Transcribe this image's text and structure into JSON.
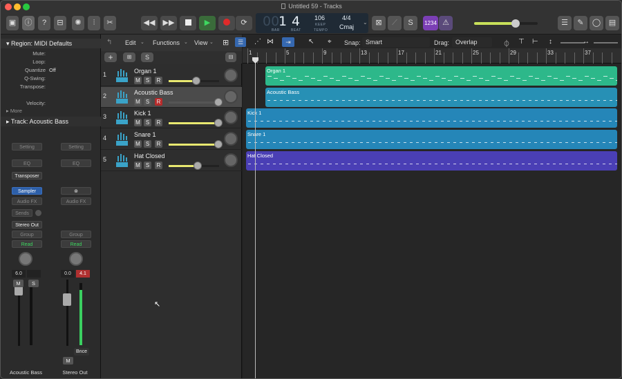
{
  "window": {
    "title": "Untitled 59 - Tracks"
  },
  "lcd": {
    "bar": "1",
    "beat": "4",
    "bar_label": "BAR",
    "beat_label": "BEAT",
    "tempo": "106",
    "keep_label": "KEEP",
    "tempo_label": "TEMPO",
    "time_sig": "4/4",
    "key": "Cmaj"
  },
  "toolbar": {
    "count_in": "1234"
  },
  "edit_toolbar": {
    "edit": "Edit",
    "functions": "Functions",
    "view": "View",
    "snap_label": "Snap:",
    "snap_value": "Smart",
    "drag_label": "Drag:",
    "drag_value": "Overlap"
  },
  "ruler": {
    "bars": [
      "1",
      "5",
      "9",
      "13",
      "17",
      "21",
      "25",
      "29",
      "33",
      "37"
    ]
  },
  "inspector": {
    "region_header": "Region: MIDI Defaults",
    "rows": [
      {
        "label": "Mute:",
        "value": ""
      },
      {
        "label": "Loop:",
        "value": ""
      },
      {
        "label": "Quantize",
        "value": "Off"
      },
      {
        "label": "Q-Swing:",
        "value": ""
      },
      {
        "label": "Transpose:",
        "value": ""
      },
      {
        "label": "",
        "value": ""
      },
      {
        "label": "Velocity:",
        "value": ""
      }
    ],
    "more": "More",
    "track_header": "Track:  Acoustic Bass",
    "strip1": {
      "setting": "Setting",
      "eq": "EQ",
      "midi_fx": "Transposer",
      "instrument": "Sampler",
      "audio_fx": "Audio FX",
      "sends": "Sends",
      "output": "Stereo Out",
      "group": "Group",
      "automation": "Read",
      "volume": "6.0",
      "mute": "M",
      "solo": "S",
      "name": "Acoustic Bass"
    },
    "strip2": {
      "setting": "Setting",
      "eq": "EQ",
      "audio_fx": "Audio FX",
      "group": "Group",
      "automation": "Read",
      "volume": "0.0",
      "peak": "4.1",
      "bounce": "Bnce",
      "mute": "M",
      "name": "Stereo Out"
    }
  },
  "tracks": [
    {
      "num": "1",
      "name": "Organ 1",
      "mute": "M",
      "solo": "S",
      "rec": "R",
      "rec_armed": false,
      "selected": false,
      "volume": 0.55
    },
    {
      "num": "2",
      "name": "Acoustic Bass",
      "mute": "M",
      "solo": "S",
      "rec": "R",
      "rec_armed": true,
      "selected": true,
      "volume": 0.98
    },
    {
      "num": "3",
      "name": "Kick 1",
      "mute": "M",
      "solo": "S",
      "rec": "R",
      "rec_armed": false,
      "selected": false,
      "volume": 0.98
    },
    {
      "num": "4",
      "name": "Snare 1",
      "mute": "M",
      "solo": "S",
      "rec": "R",
      "rec_armed": false,
      "selected": false,
      "volume": 0.98
    },
    {
      "num": "5",
      "name": "Hat Closed",
      "mute": "M",
      "solo": "S",
      "rec": "R",
      "rec_armed": false,
      "selected": false,
      "volume": 0.58
    }
  ],
  "regions": [
    {
      "name": "Organ 1",
      "color": "#2db88a"
    },
    {
      "name": "Acoustic Bass",
      "color": "#2790b5"
    },
    {
      "name": "Kick 1",
      "color": "#2586b8"
    },
    {
      "name": "Snare 1",
      "color": "#2586b8"
    },
    {
      "name": "Hat Closed",
      "color": "#4a3fb5"
    }
  ],
  "track_toolbar": {
    "solo": "S"
  }
}
